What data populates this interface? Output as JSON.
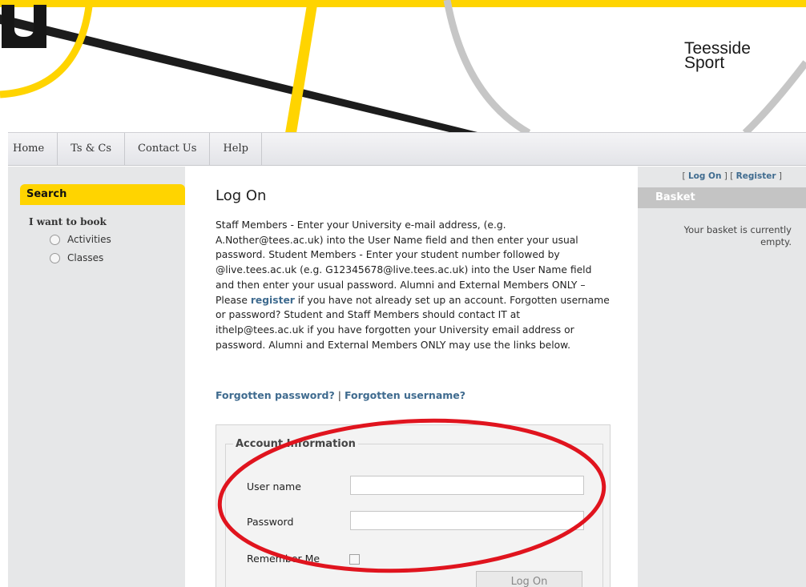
{
  "brand": {
    "logo_line1": "Teesside",
    "logo_line2": "Sport",
    "accent_color": "#ffd400",
    "link_color": "#3f6b8f"
  },
  "nav": {
    "items": [
      {
        "label": "Home"
      },
      {
        "label": "Ts & Cs"
      },
      {
        "label": "Contact Us"
      },
      {
        "label": "Help"
      }
    ]
  },
  "sidebar": {
    "search_title": "Search",
    "want_to_book": "I want to book",
    "options": [
      {
        "label": "Activities"
      },
      {
        "label": "Classes"
      }
    ]
  },
  "main": {
    "title": "Log On",
    "intro_part1": "Staff Members - Enter your University e-mail address, (e.g. A.Nother@tees.ac.uk) into the User Name field and then enter your usual password. Student Members - Enter your student number followed by @live.tees.ac.uk (e.g. G12345678@live.tees.ac.uk) into the User Name field and then enter your usual password. Alumni and External Members ONLY – Please ",
    "intro_link": "register",
    "intro_part2": " if you have not already set up an account. Forgotten username or password? Student and Staff Members should contact IT at ithelp@tees.ac.uk if you have forgotten your University email address or password. Alumni and External Members ONLY may use the links below.",
    "forgot_password": "Forgotten password?",
    "separator": "|",
    "forgot_username": "Forgotten username?",
    "form": {
      "legend": "Account Information",
      "username_label": "User name",
      "username_value": "",
      "password_label": "Password",
      "password_value": "",
      "remember_label": "Remember Me",
      "remember_checked": false,
      "submit_label": "Log On"
    }
  },
  "right": {
    "bracket_open": "[",
    "logon_link": "Log On",
    "bracket_mid": "] [",
    "register_link": "Register",
    "bracket_close": "]",
    "basket_title": "Basket",
    "basket_message": "Your basket is currently empty."
  },
  "annotation_color": "#e0141e"
}
